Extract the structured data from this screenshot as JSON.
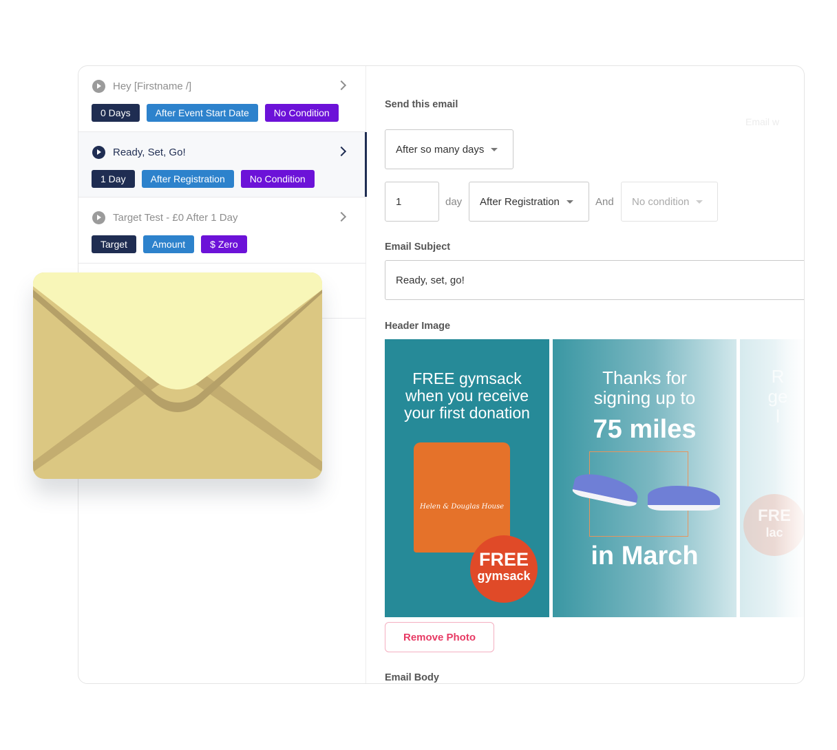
{
  "sequence": {
    "items": [
      {
        "title": "Hey [Firstname /]",
        "active": false,
        "tags": [
          {
            "label": "0 Days",
            "color": "navy"
          },
          {
            "label": "After Event Start Date",
            "color": "blue"
          },
          {
            "label": "No Condition",
            "color": "purple"
          }
        ]
      },
      {
        "title": "Ready, Set, Go!",
        "active": true,
        "tags": [
          {
            "label": "1 Day",
            "color": "navy"
          },
          {
            "label": "After Registration",
            "color": "blue"
          },
          {
            "label": "No Condition",
            "color": "purple"
          }
        ]
      },
      {
        "title": "Target Test - £0 After 1 Day",
        "active": false,
        "tags": [
          {
            "label": "Target",
            "color": "navy"
          },
          {
            "label": "Amount",
            "color": "blue"
          },
          {
            "label": "$ Zero",
            "color": "purple"
          }
        ]
      }
    ]
  },
  "editor": {
    "send_label": "Send this email",
    "ghost_text": "Email w",
    "send_type": "After so many days",
    "day_count": "1",
    "day_unit": "day",
    "trigger": "After Registration",
    "and_label": "And",
    "condition": "No condition",
    "subject_label": "Email Subject",
    "subject_value": "Ready, set, go!",
    "header_image_label": "Header Image",
    "images": [
      {
        "line1": "FREE gymsack",
        "line2": "when you receive",
        "line3": "your first donation",
        "bag_brand": "Helen & Douglas House",
        "badge_top": "FREE",
        "badge_bottom": "gymsack"
      },
      {
        "line1": "Thanks for",
        "line2": "signing up to",
        "headline": "75 miles",
        "footer": "in March"
      },
      {
        "line1": "R",
        "line2": "ge",
        "line3": "l",
        "badge_top": "FRE",
        "badge_bottom": "lac"
      }
    ],
    "remove_photo_label": "Remove Photo",
    "body_label": "Email Body"
  },
  "colors": {
    "navy": "#1f2d52",
    "blue": "#2d82cc",
    "purple": "#6c12d8",
    "danger": "#e73a64",
    "teal": "#268a98",
    "envelope_body": "#dbc782",
    "envelope_flap": "#f8f6b8"
  }
}
